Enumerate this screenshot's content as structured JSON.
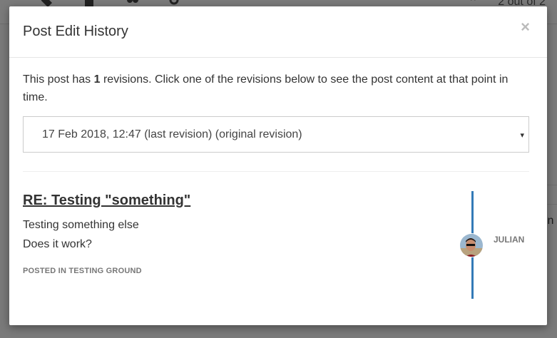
{
  "background": {
    "counter": "2 out of 2",
    "side_text": "hin",
    "toolbar_icons": [
      "tag-icon",
      "lock-icon",
      "users-icon",
      "gears-icon"
    ],
    "nav_icons": [
      "double-chevron-up-icon",
      "chevron-up-icon"
    ]
  },
  "modal": {
    "title": "Post Edit History",
    "close_label": "×",
    "intro_prefix": "This post has ",
    "revision_count": "1",
    "intro_suffix": " revisions. Click one of the revisions below to see the post content at that point in time.",
    "select": {
      "value": "17 Feb 2018, 12:47 (last revision) (original revision)",
      "caret": "▾"
    },
    "post": {
      "title": "RE: Testing \"something\"",
      "lines": [
        "Testing something else",
        "Does it work?"
      ],
      "category": "Posted in Testing Ground",
      "author": "julian"
    }
  },
  "colors": {
    "accent": "#337ab7",
    "overlay": "rgba(0,0,0,0.5)"
  }
}
